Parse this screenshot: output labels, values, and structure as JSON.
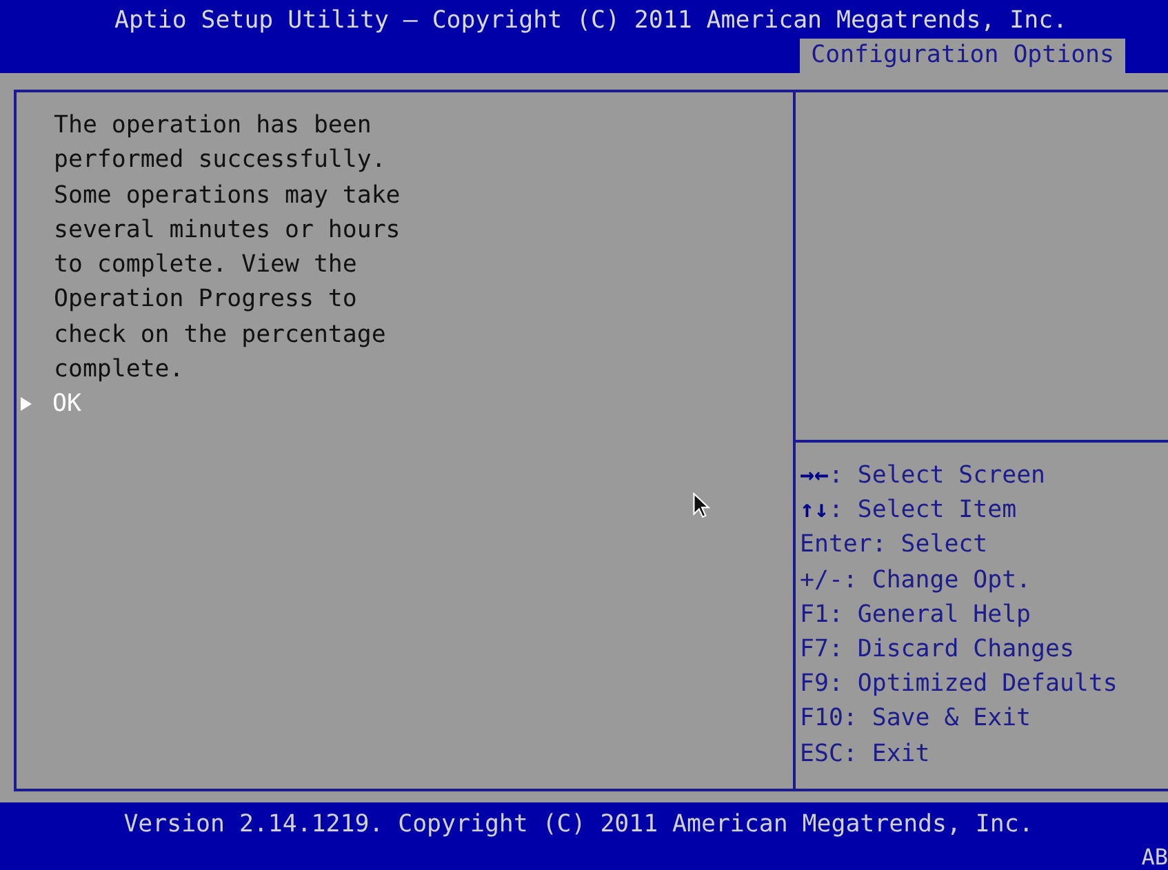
{
  "header": {
    "title": "Aptio Setup Utility – Copyright (C) 2011 American Megatrends, Inc.",
    "tabs": [
      {
        "label": "Configuration Options",
        "selected": true
      }
    ]
  },
  "main": {
    "message": "The operation has been performed successfully. Some operations may take several minutes or hours to complete. View the Operation Progress to check on the percentage complete.",
    "items": [
      {
        "label": "OK",
        "selected": true
      }
    ]
  },
  "help": [
    {
      "key": "→←",
      "text": ": Select Screen"
    },
    {
      "key": "↑↓",
      "text": ": Select Item"
    },
    {
      "text": "Enter: Select"
    },
    {
      "text": "+/-: Change Opt."
    },
    {
      "text": "F1: General Help"
    },
    {
      "text": "F7: Discard Changes"
    },
    {
      "text": "F9: Optimized Defaults"
    },
    {
      "text": "F10: Save & Exit"
    },
    {
      "text": "ESC: Exit"
    }
  ],
  "footer": {
    "version": "Version 2.14.1219. Copyright (C) 2011 American Megatrends, Inc.",
    "corner": "AB"
  }
}
